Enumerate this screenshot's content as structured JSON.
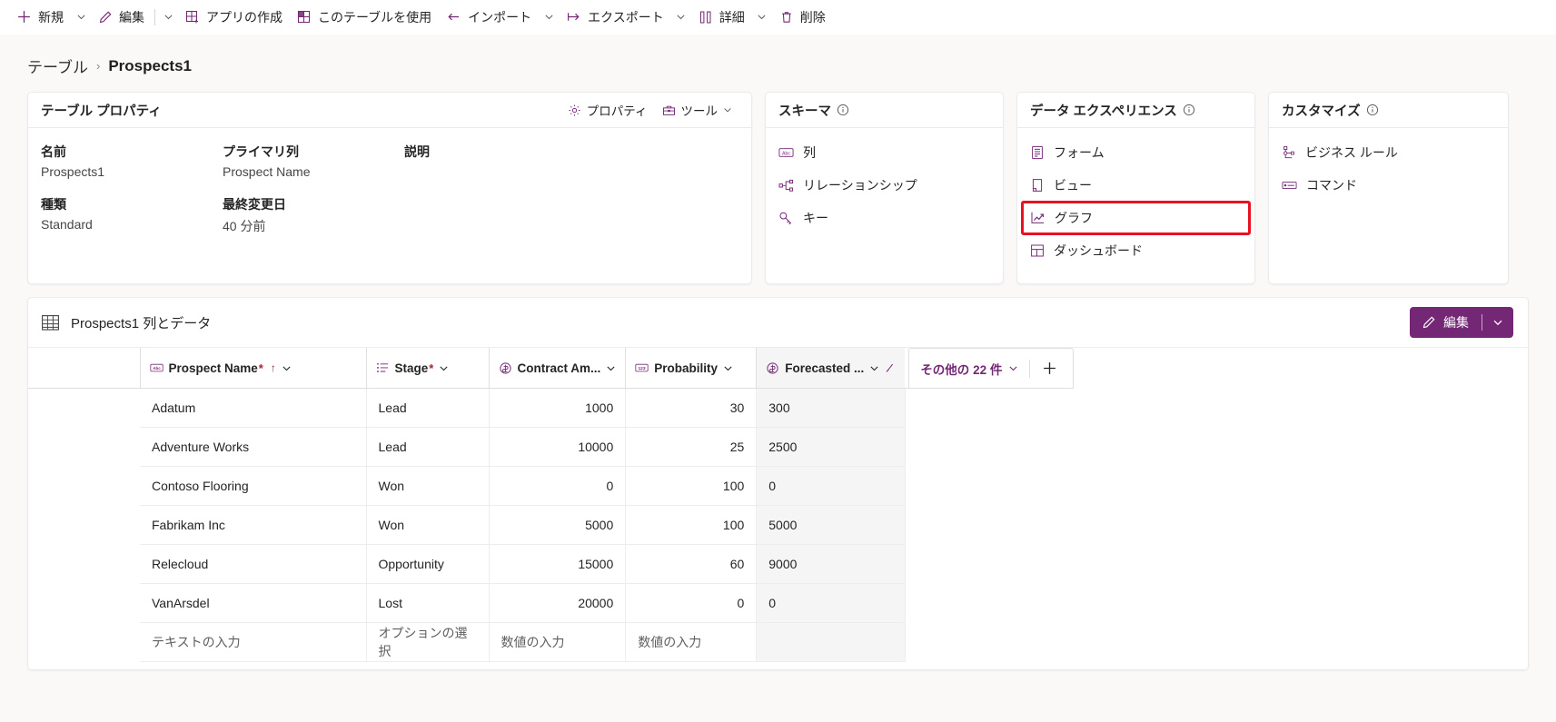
{
  "toolbar": {
    "items": [
      {
        "label": "新規",
        "icon": "plus-icon",
        "caret": true
      },
      {
        "label": "編集",
        "icon": "pencil-icon",
        "caret": true,
        "sep_before_caret": true
      },
      {
        "label": "アプリの作成",
        "icon": "app-grid-icon",
        "caret": false
      },
      {
        "label": "このテーブルを使用",
        "icon": "table-grid-icon",
        "caret": false
      },
      {
        "label": "インポート",
        "icon": "import-arrow-icon",
        "caret": true
      },
      {
        "label": "エクスポート",
        "icon": "export-arrow-icon",
        "caret": true
      },
      {
        "label": "詳細",
        "icon": "columns-icon",
        "caret": true
      },
      {
        "label": "削除",
        "icon": "trash-icon",
        "caret": false
      }
    ]
  },
  "breadcrumb": {
    "parent": "テーブル",
    "separator": "›",
    "current": "Prospects1"
  },
  "properties_card": {
    "title": "テーブル プロパティ",
    "actions": [
      {
        "label": "プロパティ",
        "icon": "gear-icon",
        "caret": false
      },
      {
        "label": "ツール",
        "icon": "toolbox-icon",
        "caret": true
      }
    ],
    "fields": [
      {
        "label": "名前",
        "value": "Prospects1"
      },
      {
        "label": "プライマリ列",
        "value": "Prospect Name"
      },
      {
        "label": "説明",
        "value": ""
      },
      {
        "label": "種類",
        "value": "Standard"
      },
      {
        "label": "最終変更日",
        "value": "40 分前"
      },
      {
        "label": "",
        "value": ""
      }
    ]
  },
  "schema_card": {
    "title": "スキーマ",
    "info_icon": "info-circle-icon",
    "items": [
      {
        "label": "列",
        "icon": "abc-icon"
      },
      {
        "label": "リレーションシップ",
        "icon": "relationship-icon"
      },
      {
        "label": "キー",
        "icon": "key-icon"
      }
    ]
  },
  "data_experience_card": {
    "title": "データ エクスペリエンス",
    "info_icon": "info-circle-icon",
    "items": [
      {
        "label": "フォーム",
        "icon": "form-icon",
        "highlighted": false
      },
      {
        "label": "ビュー",
        "icon": "view-icon",
        "highlighted": false
      },
      {
        "label": "グラフ",
        "icon": "chart-line-icon",
        "highlighted": true
      },
      {
        "label": "ダッシュボード",
        "icon": "dashboard-icon",
        "highlighted": false
      }
    ]
  },
  "customize_card": {
    "title": "カスタマイズ",
    "info_icon": "info-circle-icon",
    "items": [
      {
        "label": "ビジネス ルール",
        "icon": "business-rule-icon"
      },
      {
        "label": "コマンド",
        "icon": "command-icon"
      }
    ]
  },
  "grid_panel": {
    "title": "Prospects1 列とデータ",
    "title_icon": "table-icon",
    "edit_button": {
      "label": "編集",
      "icon": "pencil-icon",
      "caret_icon": "chevron-down-icon"
    },
    "more_columns": {
      "label": "その他の 22 件",
      "caret_icon": "chevron-down-icon"
    },
    "add_column": {
      "icon": "plus-icon"
    },
    "columns": [
      {
        "key": "name",
        "label": "Prospect Name",
        "icon": "abc-icon",
        "required": true,
        "sorted": "asc",
        "caret": true
      },
      {
        "key": "stage",
        "label": "Stage",
        "icon": "choice-list-icon",
        "required": true,
        "sorted": "",
        "caret": true
      },
      {
        "key": "contract",
        "label": "Contract Am...",
        "icon": "currency-icon",
        "required": false,
        "sorted": "",
        "caret": true
      },
      {
        "key": "probability",
        "label": "Probability",
        "icon": "number-123-icon",
        "required": false,
        "sorted": "",
        "caret": true
      },
      {
        "key": "forecasted",
        "label": "Forecasted ...",
        "icon": "currency-icon",
        "required": false,
        "sorted": "",
        "caret": true,
        "formula": true,
        "selected": true
      }
    ],
    "rows": [
      {
        "name": "Adatum",
        "stage": "Lead",
        "contract": "1000",
        "probability": "30",
        "forecasted": "300"
      },
      {
        "name": "Adventure Works",
        "stage": "Lead",
        "contract": "10000",
        "probability": "25",
        "forecasted": "2500"
      },
      {
        "name": "Contoso Flooring",
        "stage": "Won",
        "contract": "0",
        "probability": "100",
        "forecasted": "0"
      },
      {
        "name": "Fabrikam Inc",
        "stage": "Won",
        "contract": "5000",
        "probability": "100",
        "forecasted": "5000"
      },
      {
        "name": "Relecloud",
        "stage": "Opportunity",
        "contract": "15000",
        "probability": "60",
        "forecasted": "9000"
      },
      {
        "name": "VanArsdel",
        "stage": "Lost",
        "contract": "20000",
        "probability": "0",
        "forecasted": "0"
      }
    ],
    "new_row_placeholders": {
      "name": "テキストの入力",
      "stage": "オプションの選択",
      "contract": "数値の入力",
      "probability": "数値の入力",
      "forecasted": ""
    }
  },
  "colors": {
    "brand_purple": "#742774",
    "highlight_red": "#e81123",
    "required_red": "#a4262c",
    "page_bg": "#faf9f8"
  }
}
